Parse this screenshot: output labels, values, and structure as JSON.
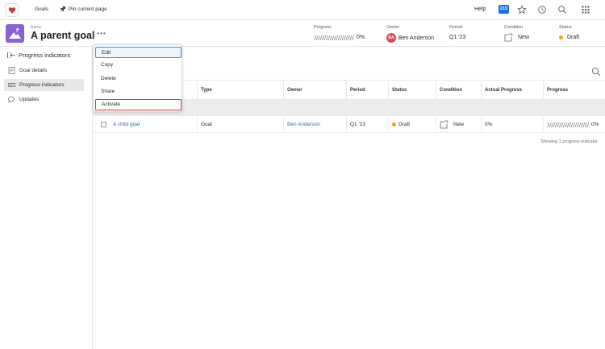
{
  "topnav": {
    "goals": "Goals",
    "pin": "Pin current page",
    "help": "Help",
    "badge": "215"
  },
  "goal": {
    "kicker": "GOAL",
    "title": "A parent goal",
    "more": "•••",
    "progress_label": "Progress",
    "progress_value": "0%",
    "owner_label": "Owner",
    "owner_initials": "BA",
    "owner_name": "Ben Anderson",
    "period_label": "Period",
    "period_value": "Q1 '23",
    "condition_label": "Condition",
    "condition_value": "New",
    "status_label": "Status",
    "status_value": "Draft"
  },
  "sidebar": {
    "head": "Progress indicators",
    "items": [
      {
        "label": "Goal details"
      },
      {
        "label": "Progress indicators"
      },
      {
        "label": "Updates"
      }
    ]
  },
  "menu": {
    "items": [
      "Edit",
      "Copy",
      "Delete",
      "Share",
      "Activate"
    ]
  },
  "table": {
    "headers": [
      "Type",
      "Owner",
      "Period",
      "Status",
      "Condition",
      "Actual Progress",
      "Progress"
    ],
    "row": {
      "name": "A child goal",
      "type": "Goal",
      "owner": "Ben Anderson",
      "period": "Q1 '23",
      "status": "Draft",
      "condition": "New",
      "actual": "0%",
      "progress": "0%"
    },
    "footer": "Showing 1 progress indicator"
  },
  "colors": {
    "accent": "#1473e6",
    "avatar": "#8a63d2",
    "owner_avatar": "#e34850",
    "draft_dot": "#e6a817",
    "highlight": "#d7373f"
  }
}
